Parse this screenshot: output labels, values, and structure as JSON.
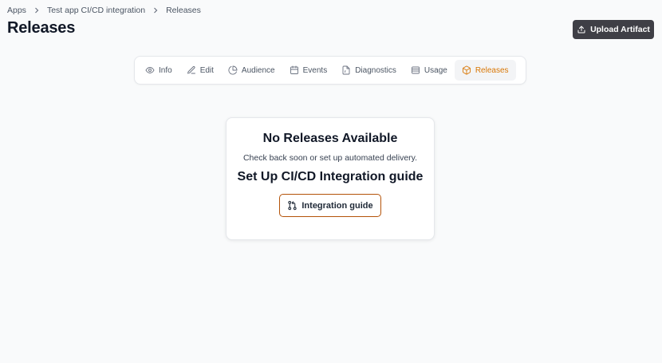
{
  "breadcrumb": {
    "items": [
      "Apps",
      "Test app CI/CD integration",
      "Releases"
    ]
  },
  "page": {
    "title": "Releases",
    "upload_label": "Upload Artifact"
  },
  "tabs": [
    {
      "label": "Info",
      "icon": "eye-icon",
      "active": false
    },
    {
      "label": "Edit",
      "icon": "pencil-icon",
      "active": false
    },
    {
      "label": "Audience",
      "icon": "pie-chart-icon",
      "active": false
    },
    {
      "label": "Events",
      "icon": "calendar-icon",
      "active": false
    },
    {
      "label": "Diagnostics",
      "icon": "file-icon",
      "active": false
    },
    {
      "label": "Usage",
      "icon": "database-icon",
      "active": false
    },
    {
      "label": "Releases",
      "icon": "package-icon",
      "active": true
    }
  ],
  "empty_state": {
    "title": "No Releases Available",
    "message": "Check back soon or set up automated delivery.",
    "subtitle": "Set Up CI/CD Integration guide",
    "button_label": "Integration guide"
  },
  "colors": {
    "accent": "#d97706",
    "dark_button": "#3f3f46",
    "guide_border": "#b45309"
  }
}
